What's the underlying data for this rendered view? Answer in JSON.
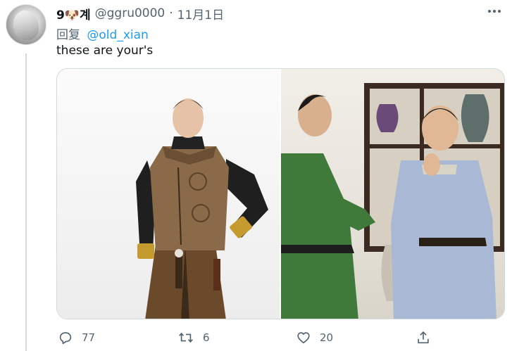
{
  "tweet": {
    "display_name": "9🐶계",
    "handle": "@ggru0000",
    "separator": "·",
    "date": "11月1日",
    "reply_prefix": "回复",
    "reply_to": "@old_xian",
    "text": "these are your's"
  },
  "actions": {
    "reply_count": "77",
    "retweet_count": "6",
    "like_count": "20"
  },
  "icons": {
    "more": "more-dots-icon",
    "reply": "reply-bubble-icon",
    "retweet": "retweet-arrows-icon",
    "like": "heart-icon",
    "share": "share-upload-icon"
  },
  "colors": {
    "link": "#1d9bf0",
    "secondary_text": "#536471",
    "primary_text": "#0f1419",
    "thread_line": "#cfd9de"
  }
}
